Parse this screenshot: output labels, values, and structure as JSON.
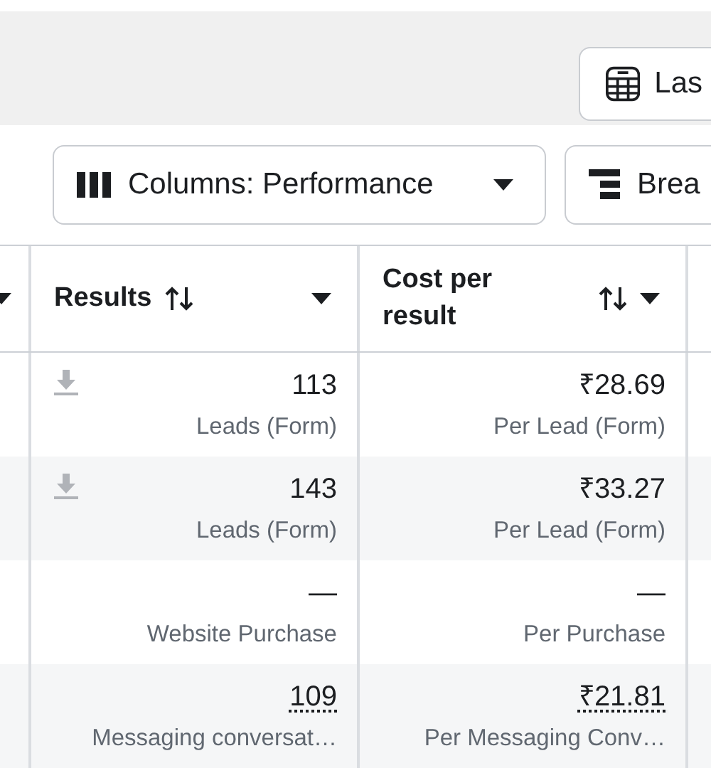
{
  "top_bar": {
    "date_button": {
      "label": "Las"
    }
  },
  "toolbar": {
    "columns_button": {
      "label": "Columns: Performance"
    },
    "breakdown_button": {
      "label": "Brea"
    }
  },
  "table": {
    "columns": [
      {
        "label": "Results"
      },
      {
        "label": "Cost per result"
      }
    ],
    "rows": [
      {
        "download": true,
        "underline": false,
        "results": {
          "value": "113",
          "unit": "Leads (Form)"
        },
        "cost": {
          "value": "₹28.69",
          "unit": "Per Lead (Form)"
        }
      },
      {
        "download": true,
        "underline": false,
        "results": {
          "value": "143",
          "unit": "Leads (Form)"
        },
        "cost": {
          "value": "₹33.27",
          "unit": "Per Lead (Form)"
        }
      },
      {
        "download": false,
        "underline": false,
        "results": {
          "value": "—",
          "unit": "Website Purchase"
        },
        "cost": {
          "value": "—",
          "unit": "Per Purchase"
        }
      },
      {
        "download": false,
        "underline": true,
        "results": {
          "value": "109",
          "unit": "Messaging conversat…"
        },
        "cost": {
          "value": "₹21.81",
          "unit": "Per Messaging Conv…"
        }
      }
    ]
  }
}
